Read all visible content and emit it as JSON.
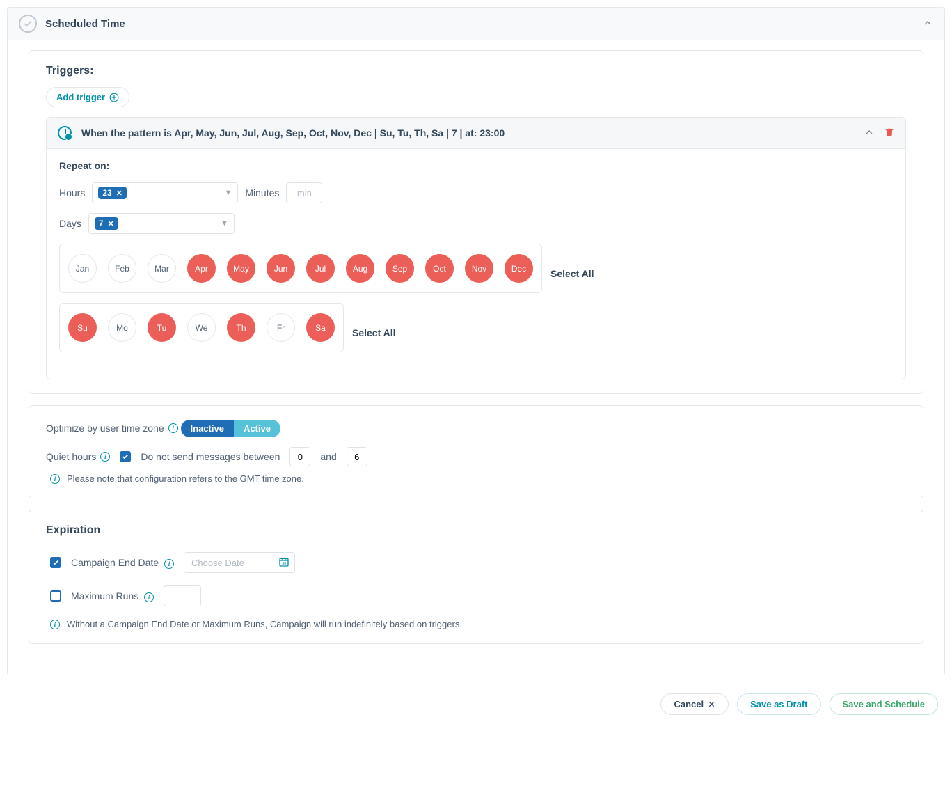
{
  "header": {
    "title": "Scheduled Time"
  },
  "triggers": {
    "title": "Triggers:",
    "add_label": "Add trigger",
    "pattern_text": "When the pattern is Apr, May, Jun, Jul, Aug, Sep, Oct, Nov, Dec | Su, Tu, Th, Sa | 7 | at: 23:00",
    "repeat_label": "Repeat on:",
    "hours_label": "Hours",
    "hours_value": "23",
    "minutes_label": "Minutes",
    "minutes_placeholder": "min",
    "days_label": "Days",
    "days_value": "7",
    "months": [
      {
        "label": "Jan",
        "selected": false
      },
      {
        "label": "Feb",
        "selected": false
      },
      {
        "label": "Mar",
        "selected": false
      },
      {
        "label": "Apr",
        "selected": true
      },
      {
        "label": "May",
        "selected": true
      },
      {
        "label": "Jun",
        "selected": true
      },
      {
        "label": "Jul",
        "selected": true
      },
      {
        "label": "Aug",
        "selected": true
      },
      {
        "label": "Sep",
        "selected": true
      },
      {
        "label": "Oct",
        "selected": true
      },
      {
        "label": "Nov",
        "selected": true
      },
      {
        "label": "Dec",
        "selected": true
      }
    ],
    "weekdays": [
      {
        "label": "Su",
        "selected": true
      },
      {
        "label": "Mo",
        "selected": false
      },
      {
        "label": "Tu",
        "selected": true
      },
      {
        "label": "We",
        "selected": false
      },
      {
        "label": "Th",
        "selected": true
      },
      {
        "label": "Fr",
        "selected": false
      },
      {
        "label": "Sa",
        "selected": true
      }
    ],
    "select_all": "Select All"
  },
  "timezone": {
    "label": "Optimize by user time zone",
    "inactive": "Inactive",
    "active": "Active",
    "quiet_label": "Quiet hours",
    "quiet_text": "Do not send messages between",
    "from": "0",
    "and": "and",
    "to": "6",
    "note": "Please note that configuration refers to the GMT time zone."
  },
  "expiration": {
    "title": "Expiration",
    "end_date_label": "Campaign End Date",
    "end_date_placeholder": "Choose Date",
    "max_runs_label": "Maximum Runs",
    "note": "Without a Campaign End Date or Maximum Runs, Campaign will run indefinitely based on triggers."
  },
  "footer": {
    "cancel": "Cancel",
    "draft": "Save as Draft",
    "save": "Save and Schedule"
  }
}
